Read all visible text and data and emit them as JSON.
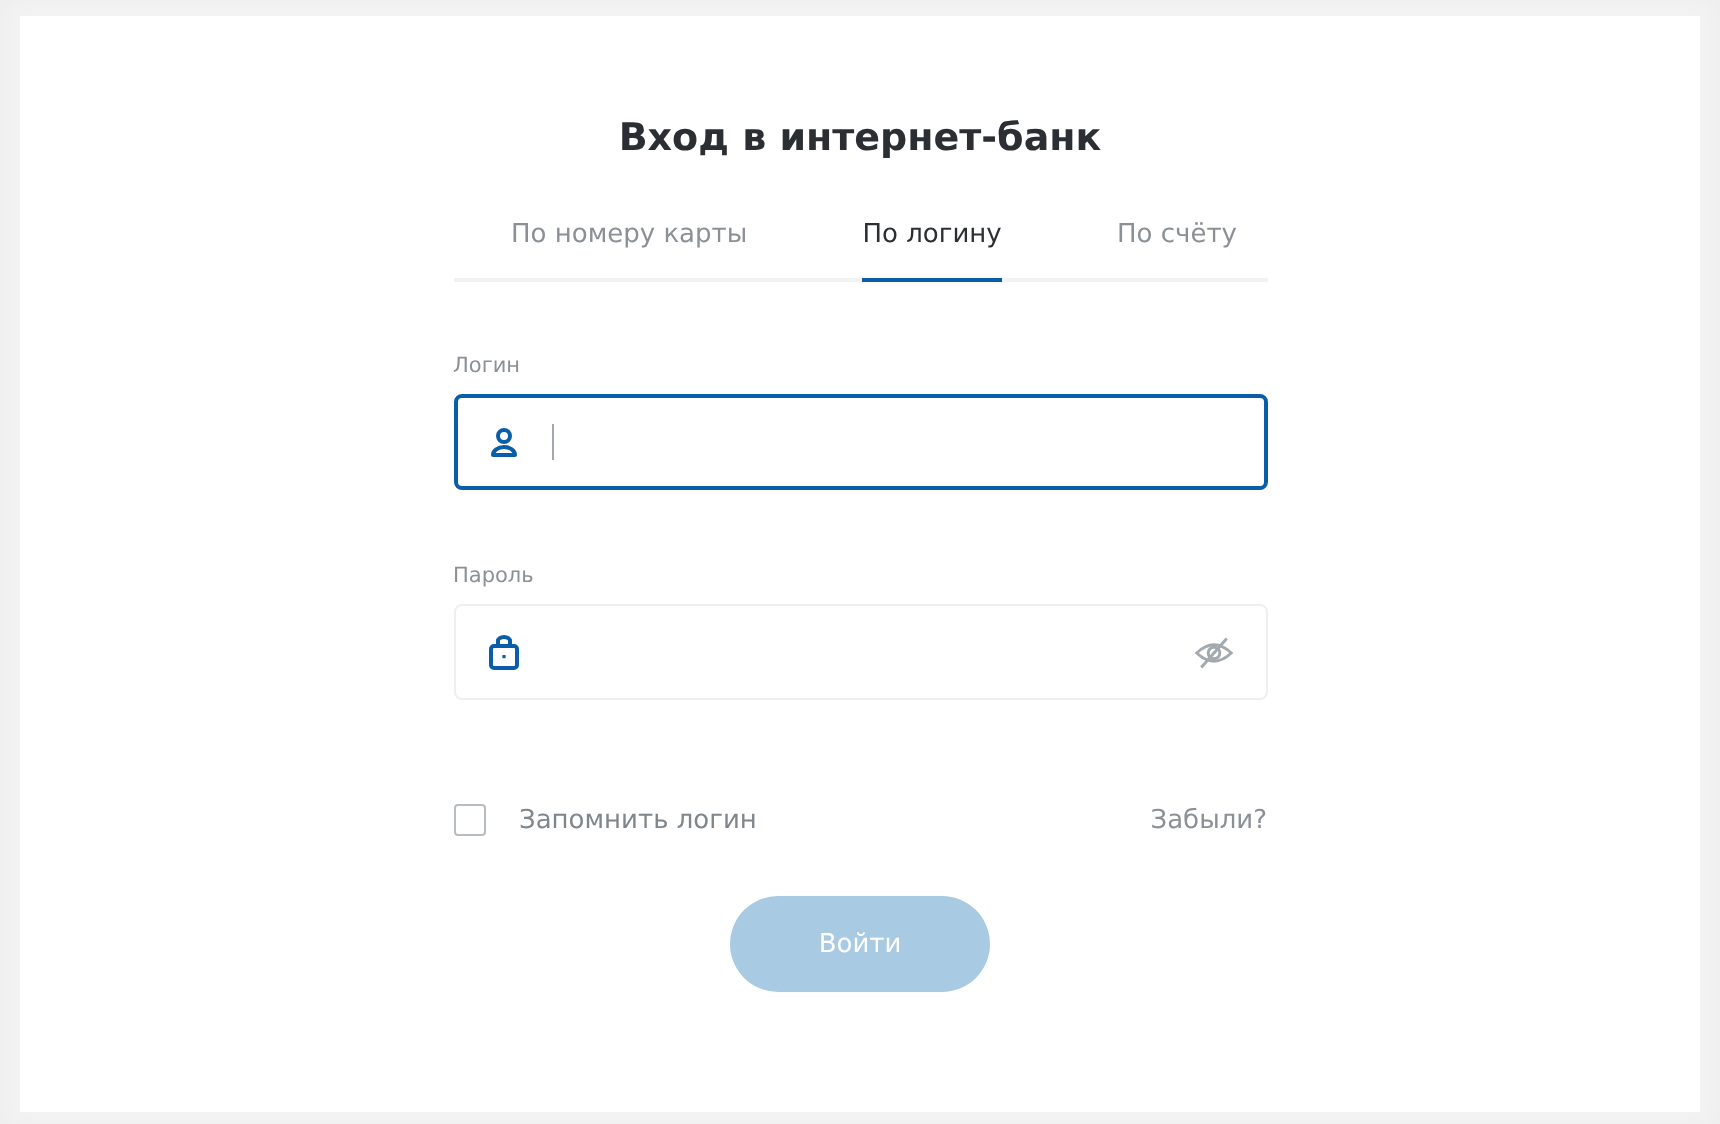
{
  "title": "Вход в интернет-банк",
  "tabs": [
    {
      "label": "По номеру карты",
      "selected": false
    },
    {
      "label": "По логину",
      "selected": true
    },
    {
      "label": "По счёту",
      "selected": false
    }
  ],
  "fields": [
    {
      "kind": "login",
      "label": "Логин",
      "focused": true
    },
    {
      "kind": "password",
      "label": "Пароль",
      "focused": false
    }
  ],
  "remember": {
    "label": "Запомнить логин",
    "checked": false
  },
  "forgot_link": "Забыли?",
  "submit": {
    "label": "Войти",
    "disabled": true
  }
}
